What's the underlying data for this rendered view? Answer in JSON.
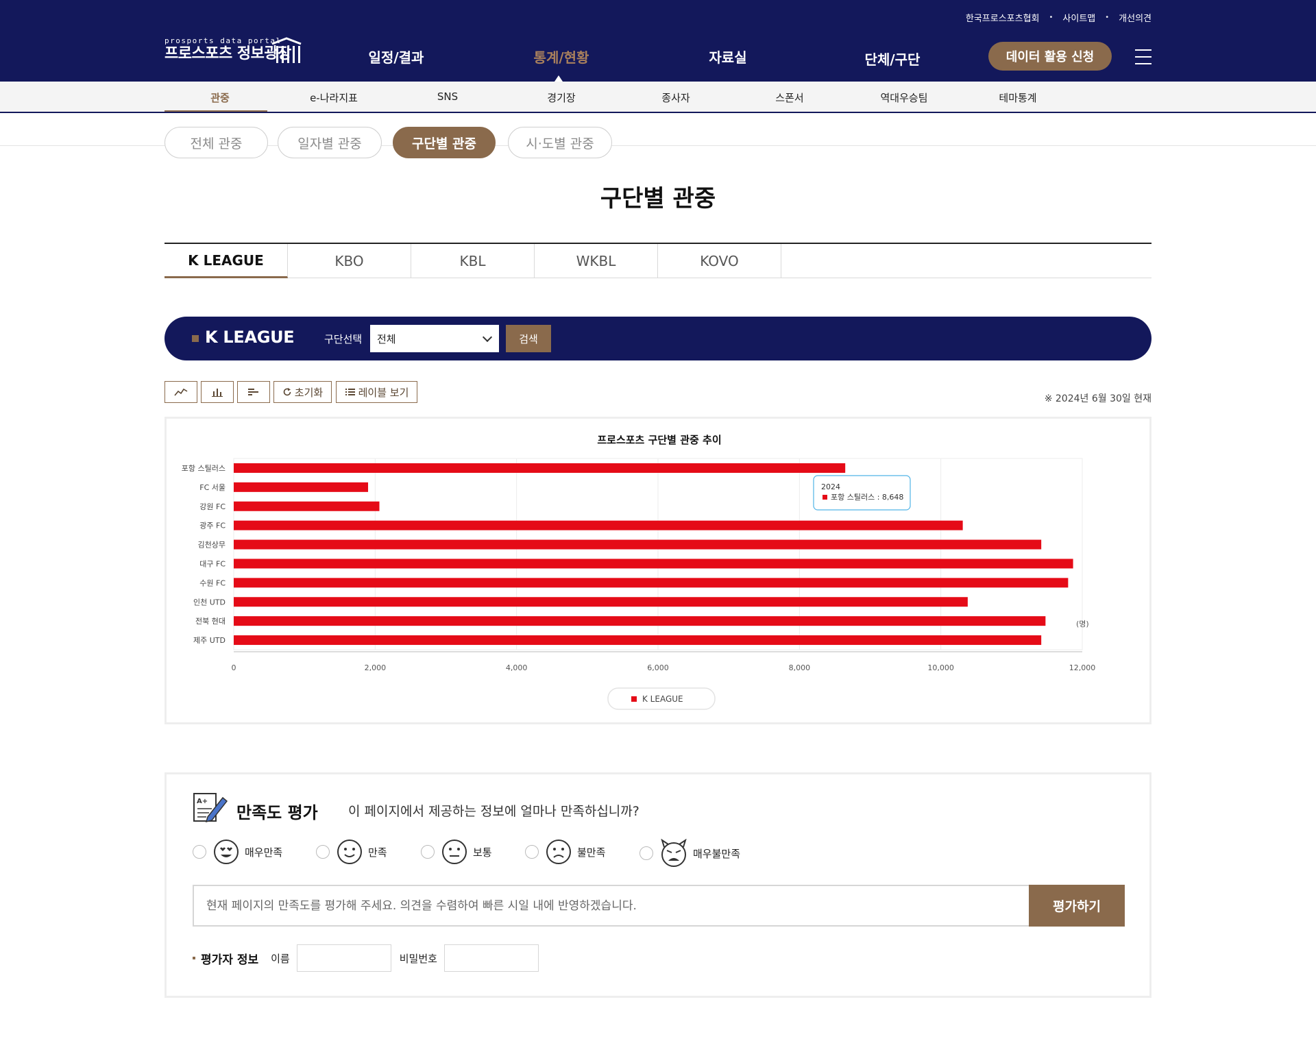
{
  "header": {
    "util_links": [
      "한국프로스포츠협회",
      "사이트맵",
      "개선의견"
    ],
    "logo_small": "prosports data portal",
    "logo_big": "프로스포츠 정보광장",
    "gnb": [
      "일정/결과",
      "통계/현황",
      "자료실",
      "단체/구단"
    ],
    "gnb_active": "통계/현황",
    "apply_button": "데이터 활용 신청"
  },
  "subnav": {
    "items": [
      "관중",
      "e-나라지표",
      "SNS",
      "경기장",
      "종사자",
      "스폰서",
      "역대우승팀",
      "테마통계"
    ],
    "active": "관중"
  },
  "pill_tabs": {
    "items": [
      "전체 관중",
      "일자별 관중",
      "구단별 관중",
      "시·도별 관중"
    ],
    "active": "구단별 관중"
  },
  "page_title": "구단별 관중",
  "league_tabs": {
    "items": [
      "K LEAGUE",
      "KBO",
      "KBL",
      "WKBL",
      "KOVO"
    ],
    "active": "K LEAGUE"
  },
  "search": {
    "league": "K LEAGUE",
    "select_label": "구단선택",
    "select_value": "전체",
    "button": "검색"
  },
  "toolbar": {
    "line_icon": "line-chart-icon",
    "column_icon": "column-chart-icon",
    "bar_icon": "bar-chart-icon",
    "reset_label": "초기화",
    "labels_label": "레이블 보기",
    "as_of": "※ 2024년 6월 30일 현재"
  },
  "chart_data": {
    "type": "bar",
    "orientation": "horizontal",
    "title": "프로스포츠 구단별 관중 추이",
    "unit": "(명)",
    "categories": [
      "포항 스틸러스",
      "FC 서울",
      "강원 FC",
      "광주 FC",
      "김천상무",
      "대구 FC",
      "수원 FC",
      "인천 UTD",
      "전북 현대",
      "제주 UTD"
    ],
    "series": [
      {
        "name": "K LEAGUE",
        "color": "#e50b17",
        "values": [
          8648,
          1900,
          2060,
          10310,
          11420,
          11870,
          11800,
          10380,
          11480,
          11420
        ]
      }
    ],
    "xlim": [
      0,
      12000
    ],
    "xticks": [
      "0",
      "2,000",
      "4,000",
      "6,000",
      "8,000",
      "10,000",
      "12,000"
    ],
    "grid": true,
    "legend_position": "bottom-center",
    "tooltip": {
      "title": "2024",
      "text": "포항 스틸러스 : 8,648"
    }
  },
  "survey": {
    "title": "만족도 평가",
    "question": "이 페이지에서 제공하는 정보에 얼마나 만족하십니까?",
    "options": [
      "매우만족",
      "만족",
      "보통",
      "불만족",
      "매우불만족"
    ],
    "comment_placeholder": "현재 페이지의 만족도를 평가해 주세요. 의견을 수렴하여 빠른 시일 내에 반영하겠습니다.",
    "submit": "평가하기",
    "evaluator_title": "평가자 정보",
    "name_label": "이름",
    "password_label": "비밀번호"
  },
  "colors": {
    "navy": "#13185b",
    "brown": "#8a6a4c",
    "bar_red": "#e50b17",
    "tooltip_border": "#4fb3e6"
  }
}
